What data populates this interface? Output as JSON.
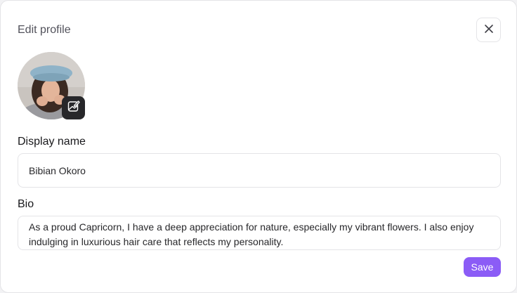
{
  "dialog": {
    "title": "Edit profile",
    "close_icon": "close-icon",
    "avatar_edit_icon": "image-edit-icon"
  },
  "form": {
    "display_name_label": "Display name",
    "display_name_value": "Bibian Okoro",
    "bio_label": "Bio",
    "bio_value": "As a proud Capricorn, I have a deep appreciation for nature, especially my vibrant flowers. I also enjoy indulging in luxurious hair care that reflects my personality."
  },
  "actions": {
    "save_label": "Save"
  },
  "colors": {
    "accent": "#8b5cf6",
    "edit_badge": "#27272a",
    "border": "#e4e4e7"
  }
}
